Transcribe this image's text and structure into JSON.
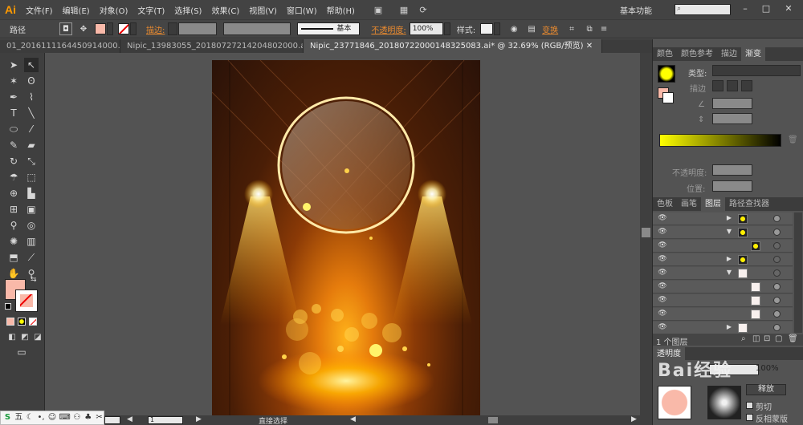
{
  "app": {
    "logo": "Ai"
  },
  "menu": [
    "文件(F)",
    "编辑(E)",
    "对象(O)",
    "文字(T)",
    "选择(S)",
    "效果(C)",
    "视图(V)",
    "窗口(W)",
    "帮助(H)"
  ],
  "workspace": "基本功能",
  "control": {
    "selection_label": "路径",
    "stroke_label": "描边:",
    "brush_label": "基本",
    "opacity_label": "不透明度:",
    "opacity_value": "100%",
    "style_label": "样式:",
    "transform_label": "变换"
  },
  "tabs": [
    {
      "label": "01_2016111164450914000.ai*",
      "active": false
    },
    {
      "label": "Nipic_13983055_20180727214204802000.ai*",
      "active": false
    },
    {
      "label": "Nipic_23771846_20180722000148325083.ai* @ 32.69% (RGB/预览)",
      "active": true
    }
  ],
  "gradient_panel": {
    "tabs": [
      "颜色",
      "颜色参考",
      "描边",
      "渐变"
    ],
    "type_label": "类型:",
    "stroke_label": "描边",
    "opacity_label": "不透明度:",
    "position_label": "位置:"
  },
  "layers_panel": {
    "tabs": [
      "色板",
      "画笔",
      "图层",
      "路径查找器"
    ],
    "footer": "1 个图层"
  },
  "transparency_panel": {
    "tab": "透明度",
    "opacity_value": "100%",
    "release_label": "释放",
    "clip_label": "剪切",
    "invert_label": "反相蒙版"
  },
  "status": {
    "zoom": "1",
    "mode": "直接选择"
  },
  "ime": {
    "label": "五"
  },
  "watermark": "Bai经验",
  "colors": {
    "fill": "#f9b9a9",
    "accent_orange": "#e98a2f",
    "gradient_start": "#ffff00",
    "gradient_end": "#000000"
  }
}
